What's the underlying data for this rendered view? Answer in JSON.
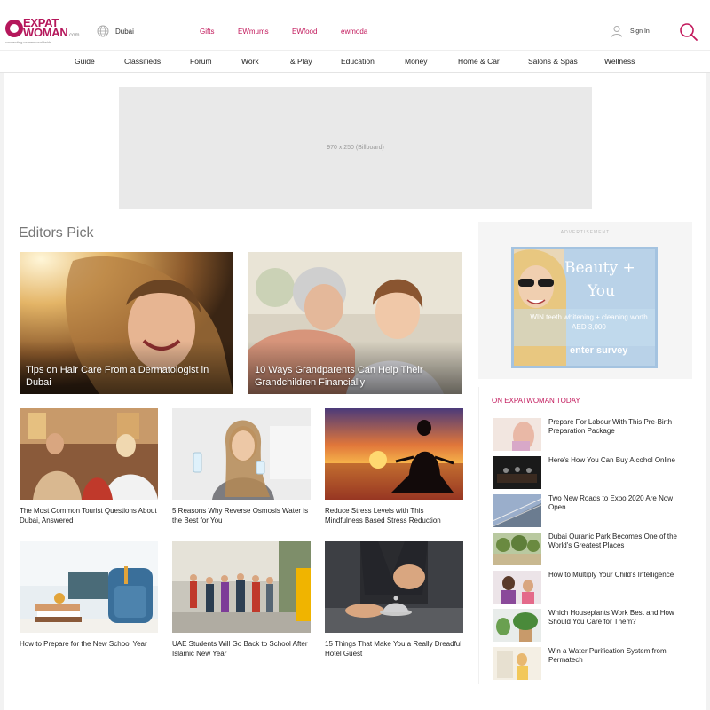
{
  "header": {
    "logo": {
      "brand_line1": "EXPAT",
      "brand_line2": "WOMAN",
      "brand_suffix": ".com",
      "tagline": "connecting women worldwide"
    },
    "location": "Dubai",
    "top_links": [
      "Gifts",
      "EWmums",
      "EWfood",
      "ewmoda"
    ],
    "sign_in": "Sign In",
    "accent_color": "#c2185b"
  },
  "nav": {
    "items": [
      "Guide",
      "Classifieds",
      "Forum",
      "Work",
      "& Play",
      "Education",
      "Money",
      "Home & Car",
      "Salons & Spas",
      "Wellness"
    ]
  },
  "billboard": {
    "label": "970 x 250 (Billboard)"
  },
  "editors_pick": {
    "heading": "Editors Pick",
    "featured": [
      {
        "title": "Tips on Hair Care From a Dermatologist in Dubai"
      },
      {
        "title": "10 Ways Grandparents Can Help Their Grandchildren Financially"
      }
    ],
    "articles": [
      {
        "title": "The Most Common Tourist Questions About Dubai, Answered"
      },
      {
        "title": "5 Reasons Why Reverse Osmosis Water is the Best for You"
      },
      {
        "title": "Reduce Stress Levels with This Mindfulness Based Stress Reduction"
      },
      {
        "title": "How to Prepare for the New School Year"
      },
      {
        "title": "UAE Students Will Go Back to School After Islamic New Year"
      },
      {
        "title": "15 Things That Make You a Really Dreadful Hotel Guest"
      }
    ]
  },
  "sidebar": {
    "ad_label": "ADVERTISEMENT",
    "ad": {
      "line1": "Beauty +",
      "line2": "You",
      "body": "WIN teeth whitening + cleaning worth AED 3,000",
      "cta": "enter survey"
    },
    "today_title": "ON EXPATWOMAN TODAY",
    "today_items": [
      {
        "title": "Prepare For Labour With This Pre-Birth Preparation Package"
      },
      {
        "title": "Here's How You Can Buy Alcohol Online"
      },
      {
        "title": "Two New Roads to Expo 2020 Are Now Open"
      },
      {
        "title": "Dubai Quranic Park Becomes One of the World's Greatest Places"
      },
      {
        "title": "How to Multiply Your Child's Intelligence"
      },
      {
        "title": "Which Houseplants Work Best and How Should You Care for Them?"
      },
      {
        "title": "Win a Water Purification System from Permatech"
      }
    ]
  }
}
